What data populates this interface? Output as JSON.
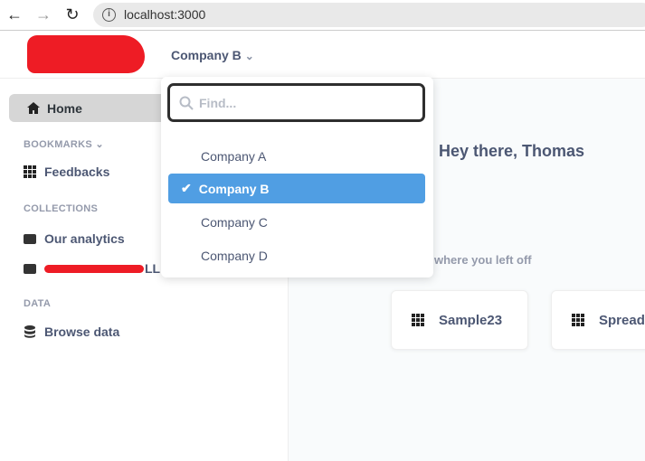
{
  "browser": {
    "url": "localhost:3000",
    "back_icon": "arrow-left",
    "forward_icon": "arrow-right",
    "reload_icon": "reload"
  },
  "header": {
    "company_selector": "Company B"
  },
  "sidebar": {
    "home": "Home",
    "bookmarks_label": "BOOKMARKS",
    "bookmarks": [
      {
        "label": "Feedbacks",
        "icon": "grid"
      }
    ],
    "collections_label": "COLLECTIONS",
    "collections": [
      {
        "label": "Our analytics"
      },
      {
        "label": "LL"
      }
    ],
    "data_label": "DATA",
    "browse_data": "Browse data"
  },
  "dropdown": {
    "search_placeholder": "Find...",
    "options": [
      {
        "label": "Company A"
      },
      {
        "label": "Company B",
        "selected": true
      },
      {
        "label": "Company C"
      },
      {
        "label": "Company D"
      }
    ],
    "selected_color": "#509ee3"
  },
  "main": {
    "greeting": "Hey there, Thomas",
    "recent_label": "where you left off",
    "cards": [
      {
        "label": "Sample23"
      },
      {
        "label": "Spread"
      }
    ]
  }
}
